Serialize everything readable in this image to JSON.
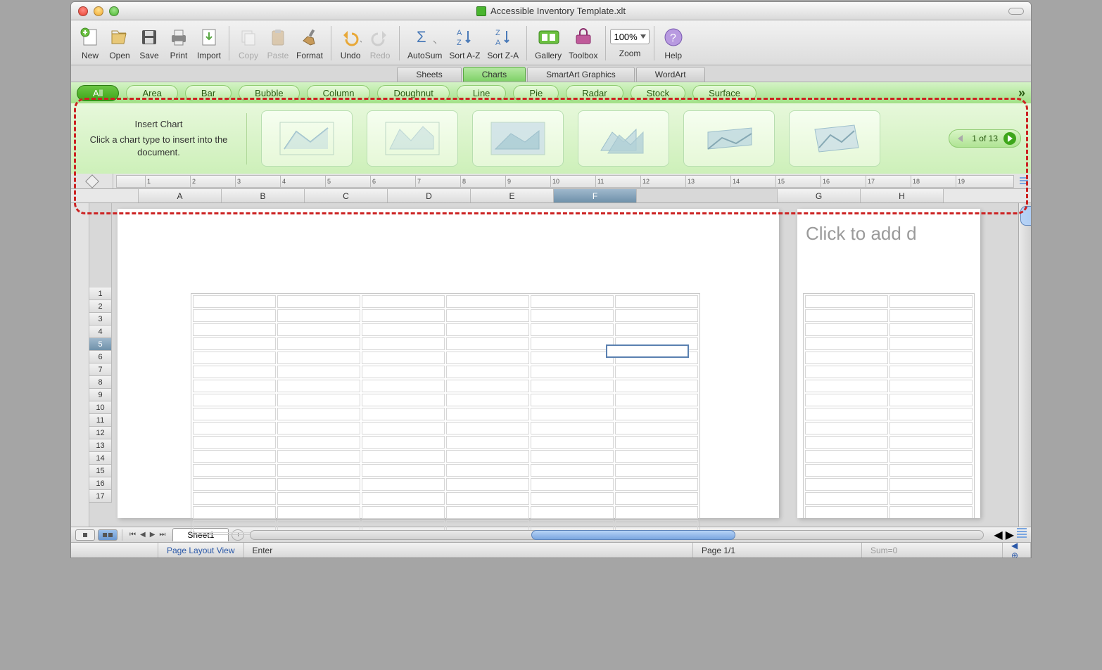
{
  "window": {
    "title": "Accessible Inventory Template.xlt"
  },
  "toolbar": {
    "new": "New",
    "open": "Open",
    "save": "Save",
    "print": "Print",
    "import": "Import",
    "copy": "Copy",
    "paste": "Paste",
    "format": "Format",
    "undo": "Undo",
    "redo": "Redo",
    "autosum": "AutoSum",
    "sortaz": "Sort A-Z",
    "sortza": "Sort Z-A",
    "gallery": "Gallery",
    "toolbox": "Toolbox",
    "zoom_label": "Zoom",
    "zoom_value": "100%",
    "help": "Help"
  },
  "gallery_tabs": [
    "Sheets",
    "Charts",
    "SmartArt Graphics",
    "WordArt"
  ],
  "gallery_tabs_active": 1,
  "chart_categories": [
    "All",
    "Area",
    "Bar",
    "Bubble",
    "Column",
    "Doughnut",
    "Line",
    "Pie",
    "Radar",
    "Stock",
    "Surface"
  ],
  "chart_categories_active": 0,
  "chart_panel": {
    "title": "Insert Chart",
    "hint": "Click a chart type to insert into the document.",
    "pager": "1 of 13"
  },
  "columns": [
    "A",
    "B",
    "C",
    "D",
    "E",
    "F"
  ],
  "columns_right": [
    "G",
    "H"
  ],
  "selected_column": "F",
  "rows": [
    "1",
    "2",
    "3",
    "4",
    "5",
    "6",
    "7",
    "8",
    "9",
    "10",
    "11",
    "12",
    "13",
    "14",
    "15",
    "16",
    "17"
  ],
  "selected_row": "5",
  "ruler_marks": [
    "1",
    "2",
    "3",
    "4",
    "5",
    "6",
    "7",
    "8",
    "9",
    "10",
    "11",
    "12",
    "13",
    "14",
    "15",
    "16",
    "17",
    "18",
    "19"
  ],
  "page2_placeholder": "Click to add d",
  "sheettabs": {
    "sheet1": "Sheet1"
  },
  "status": {
    "view": "Page Layout View",
    "mode": "Enter",
    "page": "Page 1/1",
    "sum": "Sum=0"
  }
}
